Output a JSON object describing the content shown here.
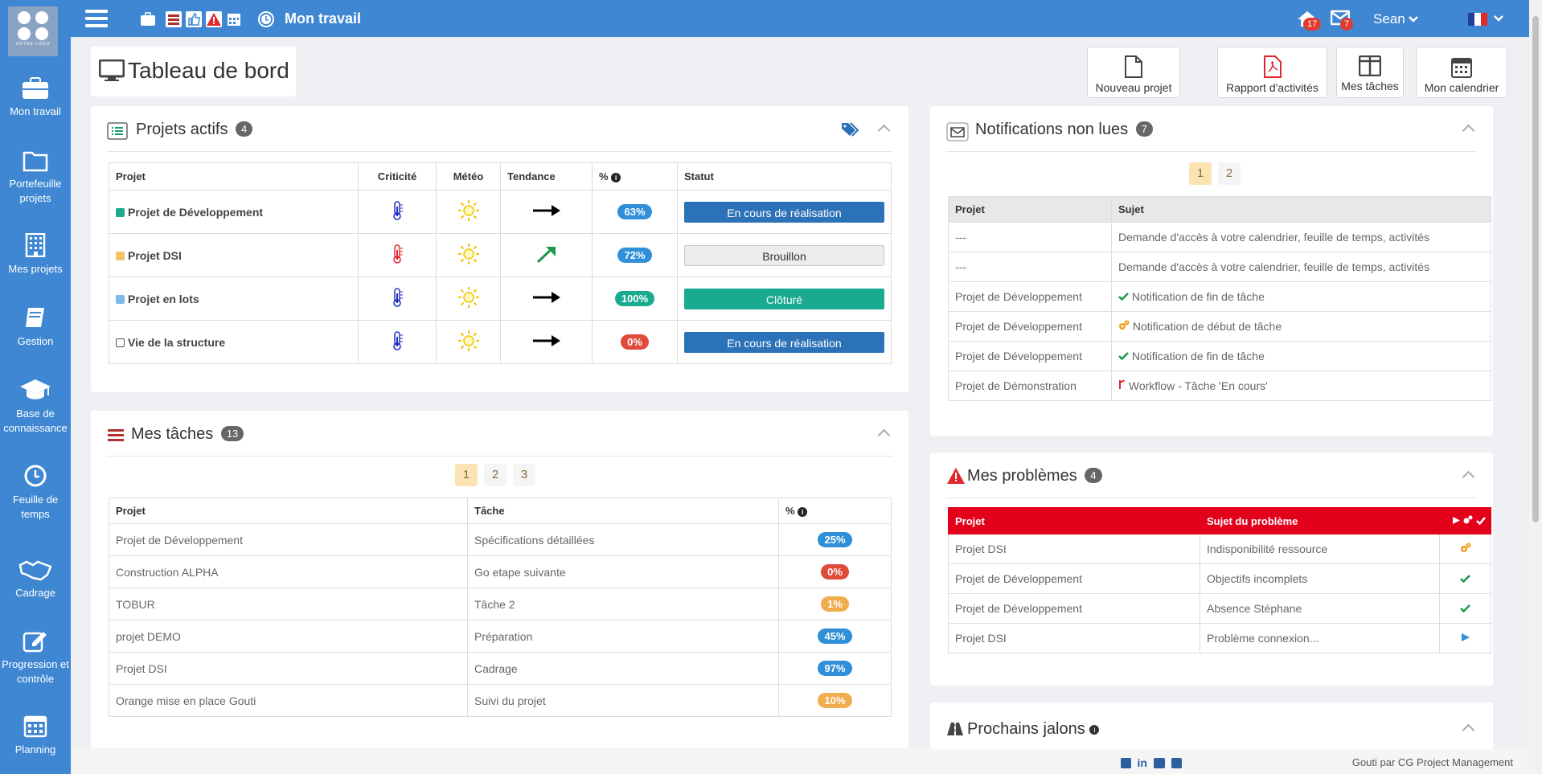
{
  "app": {
    "title": "Mon travail",
    "user": "Sean",
    "logo_text": "VOTRE LOGO"
  },
  "topbar": {
    "alerts_count": "17",
    "messages_count": "7"
  },
  "sidebar": {
    "items": [
      {
        "label": "Mon travail",
        "icon": "briefcase-icon"
      },
      {
        "label": "Portefeuille projets",
        "icon": "folder-icon"
      },
      {
        "label": "Mes projets",
        "icon": "building-icon"
      },
      {
        "label": "Gestion",
        "icon": "book-icon"
      },
      {
        "label": "Base de connaissance",
        "icon": "graduation-cap-icon"
      },
      {
        "label": "Feuille de temps",
        "icon": "clock-icon"
      },
      {
        "label": "Cadrage",
        "icon": "handshake-icon"
      },
      {
        "label": "Progression et contrôle",
        "icon": "edit-icon"
      },
      {
        "label": "Planning",
        "icon": "calendar-icon"
      }
    ]
  },
  "page": {
    "title": "Tableau de bord"
  },
  "actions": {
    "new_project": "Nouveau projet",
    "activity_report": "Rapport d'activités",
    "my_tasks": "Mes tâches",
    "my_calendar": "Mon calendrier"
  },
  "projects": {
    "title": "Projets actifs",
    "count": "4",
    "headers": {
      "project": "Projet",
      "criticity": "Criticité",
      "weather": "Météo",
      "trend": "Tendance",
      "pct": "%",
      "status": "Statut"
    },
    "rows": [
      {
        "name": "Projet de Développement",
        "color": "#1aaa8f",
        "thermo": "blue",
        "trend": "flat",
        "pct": "63%",
        "pct_color": "#2f8fd8",
        "status": "En cours de réalisation",
        "status_style": "blue"
      },
      {
        "name": "Projet DSI",
        "color": "#f4c46a",
        "thermo": "red",
        "trend": "up",
        "pct": "72%",
        "pct_color": "#2f8fd8",
        "status": "Brouillon",
        "status_style": "grey"
      },
      {
        "name": "Projet en lots",
        "color": "#7db8e8",
        "thermo": "blue",
        "trend": "flat",
        "pct": "100%",
        "pct_color": "#1aaa8f",
        "status": "Clôturé",
        "status_style": "green"
      },
      {
        "name": "Vie de la structure",
        "color": "#ffffff",
        "thermo": "blue",
        "trend": "flat",
        "pct": "0%",
        "pct_color": "#e04a3a",
        "status": "En cours de réalisation",
        "status_style": "blue"
      }
    ]
  },
  "tasks": {
    "title": "Mes tâches",
    "count": "13",
    "pages": [
      "1",
      "2",
      "3"
    ],
    "headers": {
      "project": "Projet",
      "task": "Tâche",
      "pct": "%"
    },
    "rows": [
      {
        "project": "Projet de Développement",
        "task": "Spécifications détaillées",
        "pct": "25%",
        "color": "#2f8fd8"
      },
      {
        "project": "Construction ALPHA",
        "task": "Go etape suivante",
        "pct": "0%",
        "color": "#e04a3a"
      },
      {
        "project": "TOBUR",
        "task": "Tâche 2",
        "pct": "1%",
        "color": "#f0ad4e"
      },
      {
        "project": "projet DEMO",
        "task": "Préparation",
        "pct": "45%",
        "color": "#2f8fd8"
      },
      {
        "project": "Projet DSI",
        "task": "Cadrage",
        "pct": "97%",
        "color": "#2f8fd8"
      },
      {
        "project": "Orange mise en place Gouti",
        "task": "Suivi du projet",
        "pct": "10%",
        "color": "#f0ad4e"
      }
    ]
  },
  "notifications": {
    "title": "Notifications non lues",
    "count": "7",
    "pages": [
      "1",
      "2"
    ],
    "headers": {
      "project": "Projet",
      "subject": "Sujet"
    },
    "rows": [
      {
        "project": "---",
        "subject": "Demande d'accès à votre calendrier, feuille de temps, activités",
        "icon": ""
      },
      {
        "project": "---",
        "subject": "Demande d'accès à votre calendrier, feuille de temps, activités",
        "icon": ""
      },
      {
        "project": "Projet de Développement",
        "subject": "Notification de fin de tâche",
        "icon": "check"
      },
      {
        "project": "Projet de Développement",
        "subject": "Notification de début de tâche",
        "icon": "gears"
      },
      {
        "project": "Projet de Développement",
        "subject": "Notification de fin de tâche",
        "icon": "check"
      },
      {
        "project": "Projet de Démonstration",
        "subject": "Workflow - Tâche 'En cours'",
        "icon": "fork"
      }
    ]
  },
  "problems": {
    "title": "Mes problèmes",
    "count": "4",
    "headers": {
      "project": "Projet",
      "subject": "Sujet du problème"
    },
    "rows": [
      {
        "project": "Projet DSI",
        "subject": "Indisponibilité ressource",
        "icon": "gears"
      },
      {
        "project": "Projet de Développement",
        "subject": "Objectifs incomplets",
        "icon": "check"
      },
      {
        "project": "Projet de Développement",
        "subject": "Absence Stéphane",
        "icon": "check"
      },
      {
        "project": "Projet DSI",
        "subject": "Problème connexion...",
        "icon": "play"
      }
    ]
  },
  "milestones": {
    "title": "Prochains jalons"
  },
  "footer": {
    "text": "Gouti par CG Project Management"
  }
}
